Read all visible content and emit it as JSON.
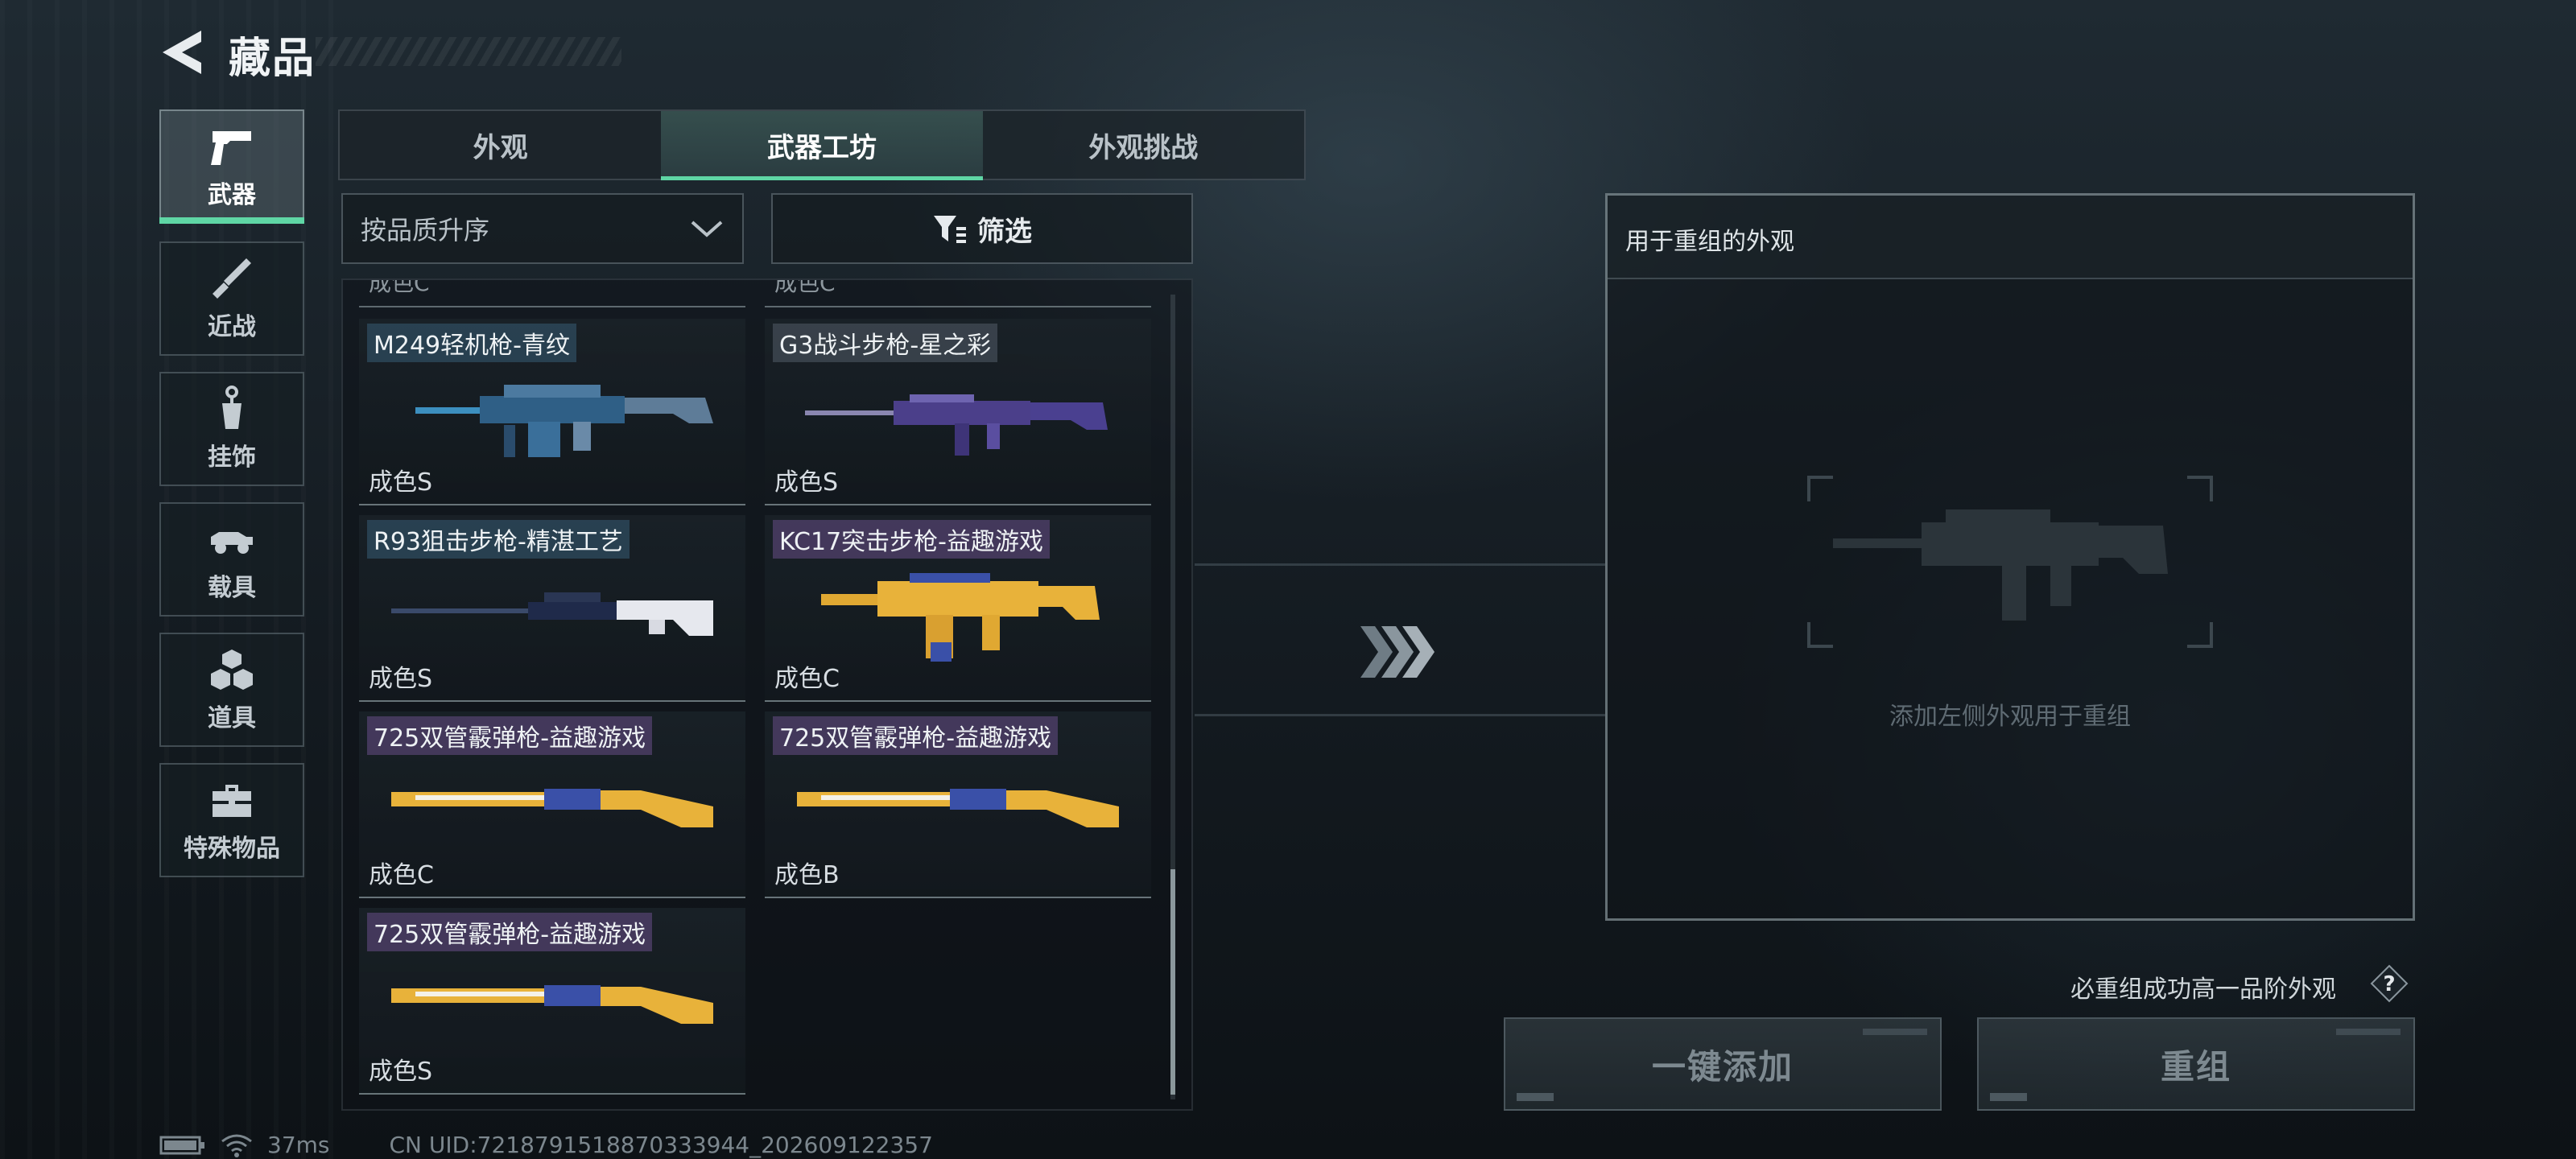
{
  "header": {
    "title": "藏品"
  },
  "categories": [
    {
      "label": "武器",
      "icon": "pistol-icon",
      "active": true
    },
    {
      "label": "近战",
      "icon": "knife-icon",
      "active": false
    },
    {
      "label": "挂饰",
      "icon": "charm-icon",
      "active": false
    },
    {
      "label": "载具",
      "icon": "vehicle-icon",
      "active": false
    },
    {
      "label": "道具",
      "icon": "cubes-icon",
      "active": false
    },
    {
      "label": "特殊物品",
      "icon": "toolbox-icon",
      "active": false
    }
  ],
  "tabs": [
    {
      "label": "外观",
      "active": false
    },
    {
      "label": "武器工坊",
      "active": true
    },
    {
      "label": "外观挑战",
      "active": false
    }
  ],
  "sort": {
    "selected": "按品质升序"
  },
  "filter": {
    "label": "筛选"
  },
  "list": {
    "cut_labels": [
      "成色C",
      "成色C"
    ],
    "items": [
      {
        "name": "M249轻机枪-青纹",
        "grade": "成色S",
        "tag_color": "blue"
      },
      {
        "name": "G3战斗步枪-星之彩",
        "grade": "成色S",
        "tag_color": "gray"
      },
      {
        "name": "R93狙击步枪-精湛工艺",
        "grade": "成色S",
        "tag_color": "blue"
      },
      {
        "name": "KC17突击步枪-益趣游戏",
        "grade": "成色C",
        "tag_color": "purple"
      },
      {
        "name": "725双管霰弹枪-益趣游戏",
        "grade": "成色C",
        "tag_color": "purple"
      },
      {
        "name": "725双管霰弹枪-益趣游戏",
        "grade": "成色B",
        "tag_color": "purple"
      },
      {
        "name": "725双管霰弹枪-益趣游戏",
        "grade": "成色S",
        "tag_color": "purple"
      }
    ]
  },
  "recombine": {
    "panel_title": "用于重组的外观",
    "placeholder": "添加左侧外观用于重组",
    "hint": "必重组成功高一品阶外观",
    "help": "?",
    "add_all_label": "一键添加",
    "recombine_label": "重组"
  },
  "status": {
    "ping": "37ms",
    "uid": "CN UID:7218791518870333944_202609122357"
  },
  "colors": {
    "accent": "#5fd6a5",
    "tag_blue": "#34566e",
    "tag_purple": "#5a4678"
  }
}
